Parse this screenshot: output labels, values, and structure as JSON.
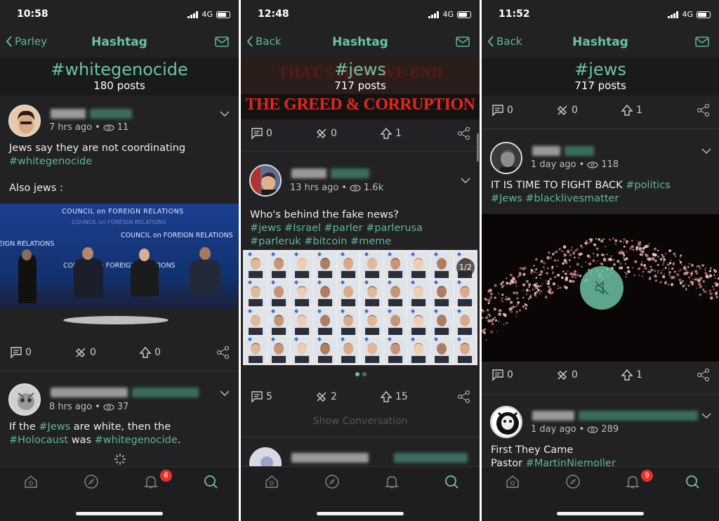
{
  "screens": [
    {
      "status_time": "10:58",
      "network": "4G",
      "back_label": "Parley",
      "title": "Hashtag",
      "hashtag": "#whitegenocide",
      "post_count": "180 posts",
      "posts": [
        {
          "time": "7 hrs ago",
          "views": "11",
          "body_line1": "Jews say they are not coordinating",
          "body_tag1": "#whitegenocide",
          "body_line3": "Also jews :",
          "image_banner_top": "COUNCIL on FOREIGN RELATIONS",
          "image_banner_mid": "COUNCIL on FOREIGN RELATIONS",
          "image_banner_left": "EIGN RELATIONS",
          "image_banner_left2": "COUNCIL on FOREIGN RELATIONS",
          "comments": "0",
          "echoes": "0",
          "upvotes": "0"
        },
        {
          "time": "8 hrs ago",
          "views": "37",
          "text_a": "If the ",
          "tag_a": "#Jews",
          "text_b": " are white, then the",
          "tag_b": "#Holocaust",
          "text_c": " was ",
          "tag_c": "#whitegenocide",
          "text_d": "."
        }
      ],
      "notif_badge": "6"
    },
    {
      "status_time": "12:48",
      "network": "4G",
      "back_label": "Back",
      "title": "Hashtag",
      "hashtag": "#jews",
      "post_count": "717 posts",
      "banner_top_text": "THAT'S HOW WE END",
      "banner_text": "THE GREED & CORRUPTION",
      "post0": {
        "comments": "0",
        "echoes": "0",
        "upvotes": "1"
      },
      "post1": {
        "time": "13 hrs ago",
        "views": "1.6k",
        "body_line1": "Who's behind the fake news?",
        "tags_line2": "#jews #Israel #parler #parlerusa",
        "tags_line3": "#parleruk #bitcoin #meme",
        "image_counter": "1/2",
        "comments": "5",
        "echoes": "2",
        "upvotes": "15"
      },
      "show_conversation": "Show Conversation"
    },
    {
      "status_time": "11:52",
      "network": "4G",
      "back_label": "Back",
      "title": "Hashtag",
      "hashtag": "#jews",
      "post_count": "717 posts",
      "bg_caption": "The p  ters",
      "post0": {
        "comments": "0",
        "echoes": "0",
        "upvotes": "1"
      },
      "post1": {
        "time": "1 day ago",
        "views": "118",
        "text_a": "IT IS TIME TO FIGHT BACK ",
        "tag_a": "#politics",
        "tag_b": "#Jews",
        "tag_c": "#blacklivesmatter",
        "comments": "0",
        "echoes": "0",
        "upvotes": "1"
      },
      "post2": {
        "time": "1 day ago",
        "views": "289",
        "line1": "First They Came",
        "line2_text": "Pastor ",
        "line2_tag": "#MartinNiemoller"
      },
      "notif_badge": "9"
    }
  ],
  "colors": {
    "accent": "#6cc3a6",
    "background": "#222224",
    "badge": "#e8322c"
  },
  "icons": [
    "chevron-left-icon",
    "mail-icon",
    "eye-icon",
    "comment-icon",
    "echo-icon",
    "upvote-icon",
    "share-icon",
    "home-icon",
    "compass-icon",
    "bell-icon",
    "search-icon",
    "chevron-down-icon",
    "mute-icon"
  ]
}
